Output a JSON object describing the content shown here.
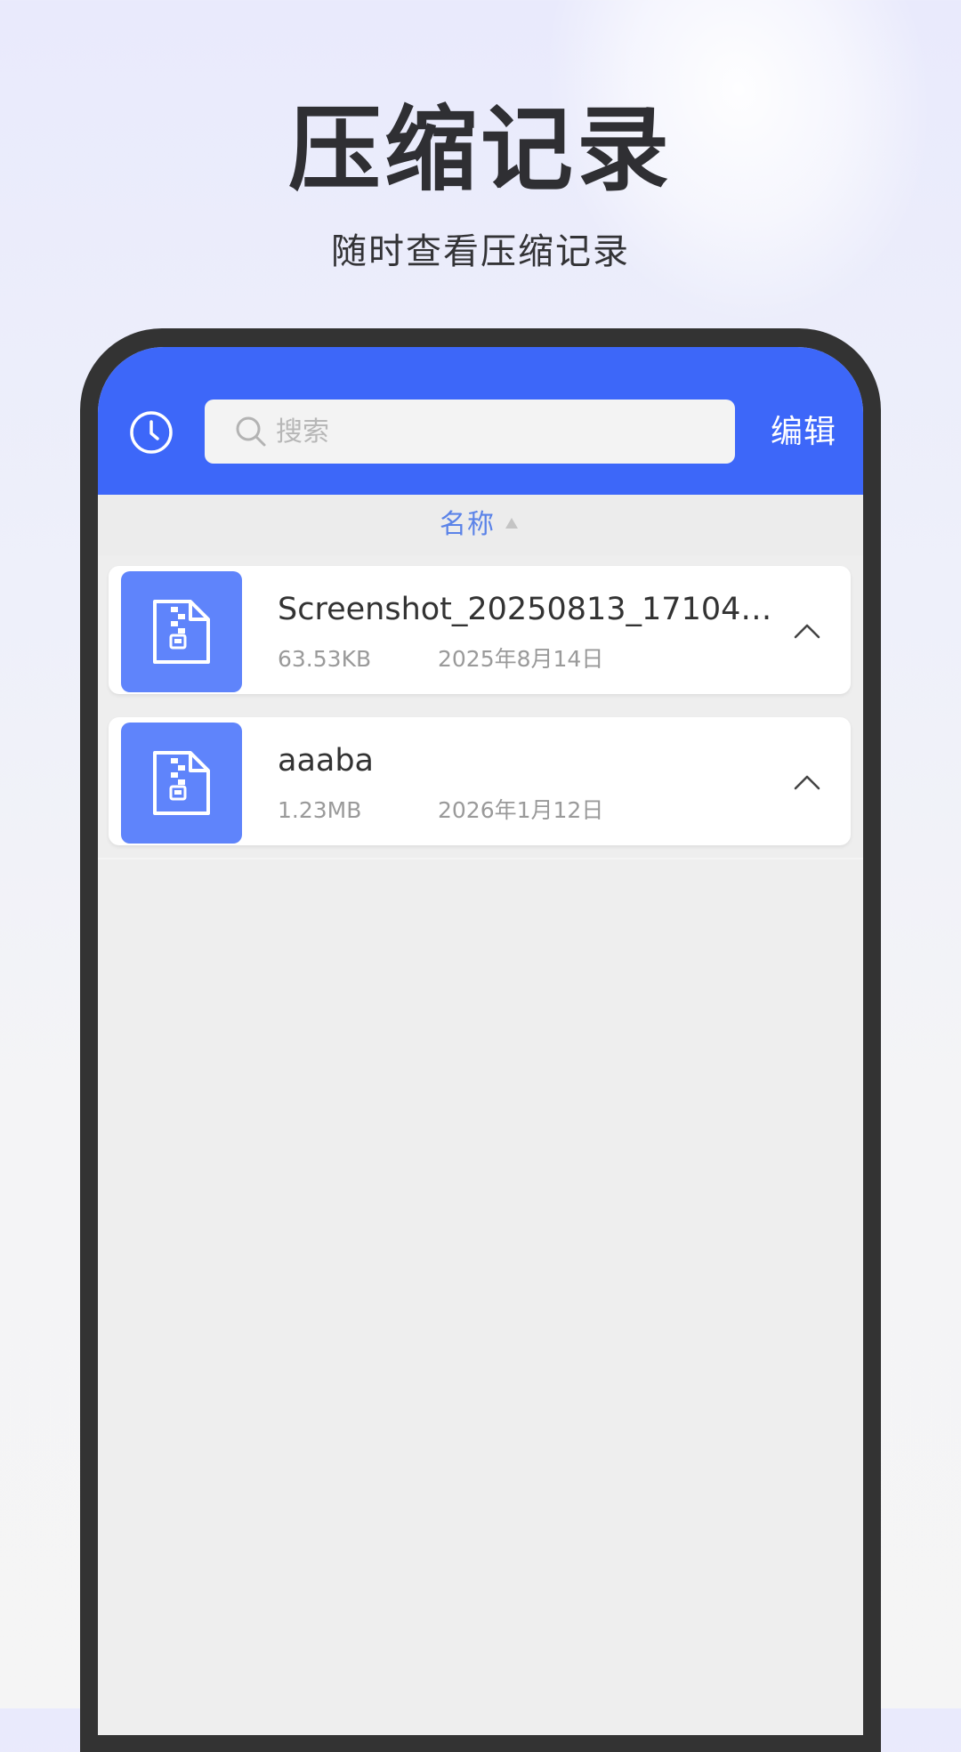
{
  "promo": {
    "title": "压缩记录",
    "subtitle": "随时查看压缩记录"
  },
  "topbar": {
    "history_icon": "clock-icon",
    "search_placeholder": "搜索",
    "search_value": "",
    "edit_label": "编辑"
  },
  "sortbar": {
    "label": "名称",
    "direction": "ascending"
  },
  "files": [
    {
      "icon": "zip-file-icon",
      "name": "Screenshot_20250813_171046...",
      "size": "63.53KB",
      "date": "2025年8月14日"
    },
    {
      "icon": "zip-file-icon",
      "name": "aaaba",
      "size": "1.23MB",
      "date": "2026年1月12日"
    }
  ],
  "colors": {
    "accent": "#3d67f9",
    "file_icon_bg": "#5f84fb",
    "sort_text": "#5b83e8"
  }
}
